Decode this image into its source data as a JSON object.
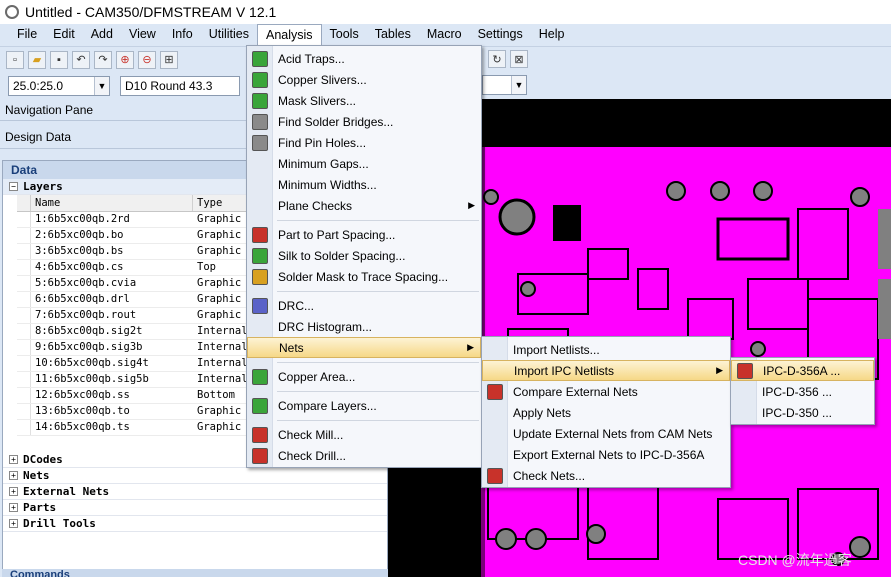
{
  "window": {
    "title": "Untitled - CAM350/DFMSTREAM V 12.1"
  },
  "menubar": [
    "File",
    "Edit",
    "Add",
    "View",
    "Info",
    "Utilities",
    "Analysis",
    "Tools",
    "Tables",
    "Macro",
    "Settings",
    "Help"
  ],
  "toolbar2": {
    "grid_value": "25.0:25.0",
    "dcode_value": "D10  Round 43.3"
  },
  "nav": {
    "pane_title": "Navigation Pane",
    "section": "Design Data",
    "data_header": "Data",
    "layers_label": "Layers",
    "columns": {
      "name": "Name",
      "type": "Type"
    },
    "layers": [
      {
        "name": "1:6b5xc00qb.2rd",
        "type": "Graphic"
      },
      {
        "name": "2:6b5xc00qb.bo",
        "type": "Graphic"
      },
      {
        "name": "3:6b5xc00qb.bs",
        "type": "Graphic"
      },
      {
        "name": "4:6b5xc00qb.cs",
        "type": "Top"
      },
      {
        "name": "5:6b5xc00qb.cvia",
        "type": "Graphic"
      },
      {
        "name": "6:6b5xc00qb.drl",
        "type": "Graphic"
      },
      {
        "name": "7:6b5xc00qb.rout",
        "type": "Graphic"
      },
      {
        "name": "8:6b5xc00qb.sig2t",
        "type": "Internal"
      },
      {
        "name": "9:6b5xc00qb.sig3b",
        "type": "Internal"
      },
      {
        "name": "10:6b5xc00qb.sig4t",
        "type": "Internal"
      },
      {
        "name": "11:6b5xc00qb.sig5b",
        "type": "Internal"
      },
      {
        "name": "12:6b5xc00qb.ss",
        "type": "Bottom"
      },
      {
        "name": "13:6b5xc00qb.to",
        "type": "Graphic"
      },
      {
        "name": "14:6b5xc00qb.ts",
        "type": "Graphic"
      }
    ],
    "tree_items": [
      "DCodes",
      "Nets",
      "External Nets",
      "Parts",
      "Drill Tools"
    ],
    "commands_label": "Commands"
  },
  "analysis_menu": {
    "items": [
      {
        "label": "Acid Traps...",
        "icon": "acid-traps-icon",
        "color": "#3aa53a"
      },
      {
        "label": "Copper Slivers...",
        "icon": "copper-slivers-icon",
        "color": "#3aa53a"
      },
      {
        "label": "Mask Slivers...",
        "icon": "mask-slivers-icon",
        "color": "#3aa53a"
      },
      {
        "label": "Find Solder Bridges...",
        "icon": "solder-bridges-icon",
        "color": "#8a8a8a"
      },
      {
        "label": "Find Pin Holes...",
        "icon": "pin-holes-icon",
        "color": "#8a8a8a"
      },
      {
        "label": "Minimum Gaps...",
        "icon": "",
        "color": ""
      },
      {
        "label": "Minimum Widths...",
        "icon": "",
        "color": ""
      },
      {
        "label": "Plane Checks",
        "icon": "",
        "color": "",
        "submenu": true
      },
      {
        "label": "Part to Part Spacing...",
        "icon": "part-spacing-icon",
        "color": "#c8322a"
      },
      {
        "label": "Silk to Solder Spacing...",
        "icon": "silk-spacing-icon",
        "color": "#3aa53a"
      },
      {
        "label": "Solder Mask to Trace Spacing...",
        "icon": "mask-trace-spacing-icon",
        "color": "#d8a020"
      },
      {
        "label": "DRC...",
        "icon": "drc-icon",
        "color": "#5a62c8"
      },
      {
        "label": "DRC Histogram...",
        "icon": "",
        "color": ""
      },
      {
        "label": "Nets",
        "icon": "",
        "color": "",
        "submenu": true
      },
      {
        "label": "Copper Area...",
        "icon": "copper-area-icon",
        "color": "#3aa53a"
      },
      {
        "label": "Compare Layers...",
        "icon": "compare-layers-icon",
        "color": "#3aa53a"
      },
      {
        "label": "Check Mill...",
        "icon": "check-mill-icon",
        "color": "#c8322a"
      },
      {
        "label": "Check Drill...",
        "icon": "check-drill-icon",
        "color": "#c8322a"
      }
    ]
  },
  "nets_menu": {
    "items": [
      {
        "label": "Import Netlists...",
        "icon": ""
      },
      {
        "label": "Import IPC Netlists",
        "icon": "",
        "submenu": true
      },
      {
        "label": "Compare External Nets",
        "icon": "compare-nets-icon"
      },
      {
        "label": "Apply Nets",
        "icon": ""
      },
      {
        "label": "Update External Nets from CAM Nets",
        "icon": ""
      },
      {
        "label": "Export External Nets to IPC-D-356A",
        "icon": ""
      },
      {
        "label": "Check Nets...",
        "icon": "check-nets-icon"
      }
    ]
  },
  "ipc_menu": {
    "items": [
      {
        "label": "IPC-D-356A ...",
        "icon": "ipc-import-icon"
      },
      {
        "label": "IPC-D-356 ...",
        "icon": ""
      },
      {
        "label": "IPC-D-350 ...",
        "icon": ""
      }
    ]
  },
  "watermark": "CSDN @流年過客",
  "colors": {
    "pcb_background": "#000000",
    "pcb_copper": "#ff00ff",
    "pcb_grey": "#808080",
    "menu_highlight": "#f6d887",
    "chrome": "#dce7f5"
  }
}
